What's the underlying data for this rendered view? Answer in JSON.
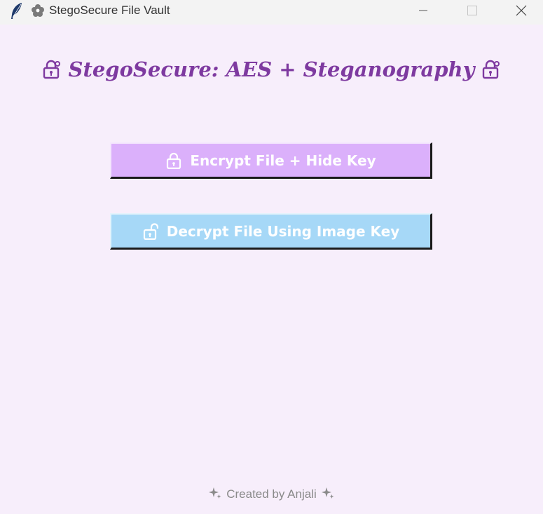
{
  "window": {
    "title": "StegoSecure File Vault",
    "app_icon": "feather-icon",
    "title_icon": "flower-icon",
    "controls": {
      "minimize": "minimize-icon",
      "maximize": "maximize-icon",
      "close": "close-icon"
    }
  },
  "main": {
    "heading": "StegoSecure: AES + Steganography",
    "heading_icon": "lock-with-key-icon",
    "heading_color": "#7e3aa0"
  },
  "buttons": {
    "encrypt": {
      "label": "Encrypt File + Hide Key",
      "icon": "locked-icon",
      "color": "#dbb0fb"
    },
    "decrypt": {
      "label": "Decrypt File Using Image Key",
      "icon": "unlocked-icon",
      "color": "#a6d8f7"
    }
  },
  "footer": {
    "text": "Created by Anjali",
    "icon": "sparkles-icon"
  },
  "colors": {
    "background": "#f7eefb",
    "titlebar": "#f3f3f3"
  }
}
